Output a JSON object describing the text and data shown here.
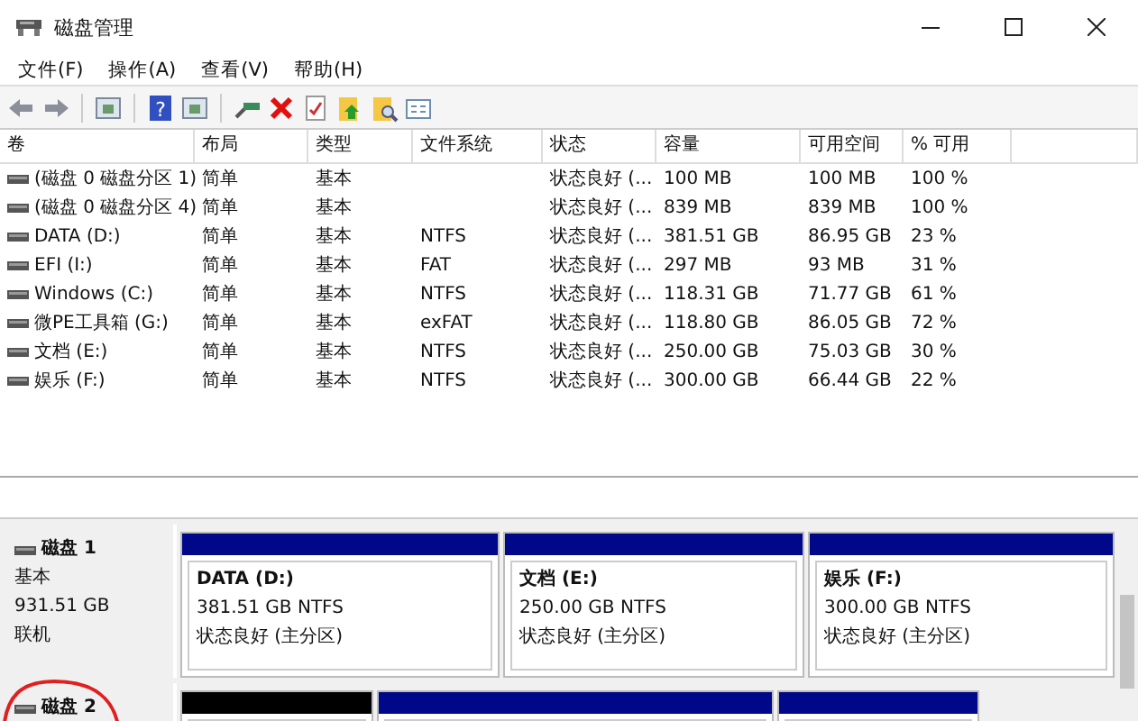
{
  "window": {
    "title": "磁盘管理"
  },
  "menu": [
    "文件(F)",
    "操作(A)",
    "查看(V)",
    "帮助(H)"
  ],
  "toolbar": {
    "help_glyph": "?"
  },
  "table": {
    "columns": [
      "卷",
      "布局",
      "类型",
      "文件系统",
      "状态",
      "容量",
      "可用空间",
      "% 可用"
    ],
    "rows": [
      [
        "(磁盘 0 磁盘分区 1)",
        "简单",
        "基本",
        "",
        "状态良好 (...",
        "100 MB",
        "100 MB",
        "100 %"
      ],
      [
        "(磁盘 0 磁盘分区 4)",
        "简单",
        "基本",
        "",
        "状态良好 (...",
        "839 MB",
        "839 MB",
        "100 %"
      ],
      [
        "DATA (D:)",
        "简单",
        "基本",
        "NTFS",
        "状态良好 (...",
        "381.51 GB",
        "86.95 GB",
        "23 %"
      ],
      [
        "EFI (I:)",
        "简单",
        "基本",
        "FAT",
        "状态良好 (...",
        "297 MB",
        "93 MB",
        "31 %"
      ],
      [
        "Windows (C:)",
        "简单",
        "基本",
        "NTFS",
        "状态良好 (...",
        "118.31 GB",
        "71.77 GB",
        "61 %"
      ],
      [
        "微PE工具箱 (G:)",
        "简单",
        "基本",
        "exFAT",
        "状态良好 (...",
        "118.80 GB",
        "86.05 GB",
        "72 %"
      ],
      [
        "文档 (E:)",
        "简单",
        "基本",
        "NTFS",
        "状态良好 (...",
        "250.00 GB",
        "75.03 GB",
        "30 %"
      ],
      [
        "娱乐 (F:)",
        "简单",
        "基本",
        "NTFS",
        "状态良好 (...",
        "300.00 GB",
        "66.44 GB",
        "22 %"
      ]
    ]
  },
  "disks": [
    {
      "name": "磁盘 1",
      "info": [
        "基本",
        "931.51 GB",
        "联机"
      ],
      "partitions": [
        {
          "kind": "primary",
          "name": "DATA  (D:)",
          "size": "381.51 GB NTFS",
          "status": "状态良好 (主分区)"
        },
        {
          "kind": "primary",
          "name": "文档  (E:)",
          "size": "250.00 GB NTFS",
          "status": "状态良好 (主分区)"
        },
        {
          "kind": "primary",
          "name": "娱乐  (F:)",
          "size": "300.00 GB NTFS",
          "status": "状态良好 (主分区)"
        }
      ]
    },
    {
      "name": "磁盘 2",
      "partitions": [
        {
          "kind": "unallocated"
        },
        {
          "kind": "primary"
        },
        {
          "kind": "primary"
        }
      ]
    }
  ]
}
